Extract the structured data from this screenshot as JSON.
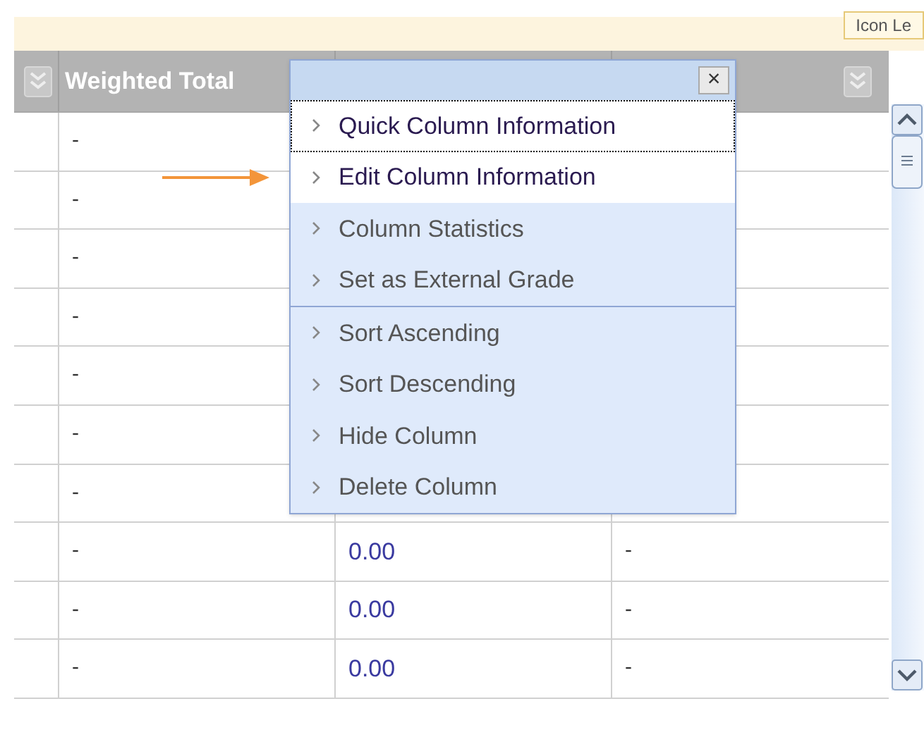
{
  "legend_tab": {
    "label": "Icon Le"
  },
  "table": {
    "columns": [
      {
        "kind": "menu"
      },
      {
        "kind": "title",
        "label": "Weighted Total"
      },
      {
        "kind": "blank"
      },
      {
        "kind": "menu"
      }
    ],
    "rows": [
      {
        "weighted_total": "-"
      },
      {
        "weighted_total": "-"
      },
      {
        "weighted_total": "-"
      },
      {
        "weighted_total": "-"
      },
      {
        "weighted_total": "-"
      },
      {
        "weighted_total": "-"
      },
      {
        "weighted_total": "-"
      },
      {
        "weighted_total": "-",
        "column_3": "0.00",
        "column_4": "-"
      },
      {
        "weighted_total": "-",
        "column_3": "0.00",
        "column_4": "-"
      },
      {
        "weighted_total": "-",
        "column_3": "0.00",
        "column_4": "-"
      }
    ]
  },
  "menu": {
    "close": "×",
    "sections": [
      [
        {
          "label": "Quick Column Information",
          "highlighted": true,
          "focused": true
        },
        {
          "label": "Edit Column Information",
          "highlighted": true,
          "focused": false
        },
        {
          "label": "Column Statistics",
          "highlighted": false,
          "focused": false
        },
        {
          "label": "Set as External Grade",
          "highlighted": false,
          "focused": false
        }
      ],
      [
        {
          "label": "Sort Ascending",
          "highlighted": false,
          "focused": false
        },
        {
          "label": "Sort Descending",
          "highlighted": false,
          "focused": false
        },
        {
          "label": "Hide Column",
          "highlighted": false,
          "focused": false
        },
        {
          "label": "Delete Column",
          "highlighted": false,
          "focused": false
        }
      ]
    ]
  }
}
